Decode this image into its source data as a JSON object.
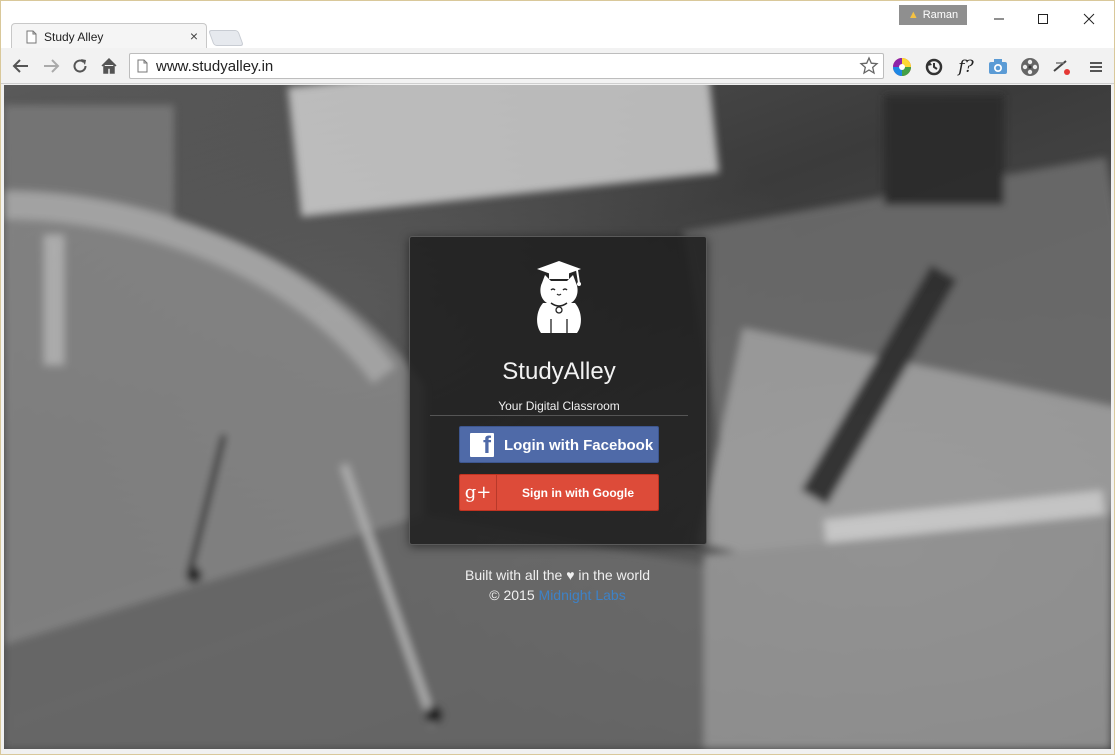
{
  "browser": {
    "tab_title": "Study Alley",
    "tab_close": "×",
    "profile_name": "Raman",
    "url": "www.studyalley.in"
  },
  "page": {
    "brand": "StudyAlley",
    "tagline": "Your Digital Classroom",
    "facebook_button": "Login with Facebook",
    "google_button": "Sign in with Google",
    "google_icon_text": "g+",
    "footer_line1_prefix": "Built with all the",
    "footer_heart": "♥",
    "footer_line1_suffix": "in the world",
    "footer_copyright": "© 2015",
    "footer_company": "Midnight Labs"
  },
  "colors": {
    "facebook": "#4f6aa8",
    "google": "#dd4b39",
    "link": "#3e82c7"
  },
  "icons": [
    "back-icon",
    "forward-icon",
    "reload-icon",
    "home-icon",
    "page-icon",
    "star-icon",
    "color-picker-icon",
    "sync-icon",
    "font-icon",
    "camera-icon",
    "film-icon",
    "extension-icon",
    "menu-icon"
  ]
}
